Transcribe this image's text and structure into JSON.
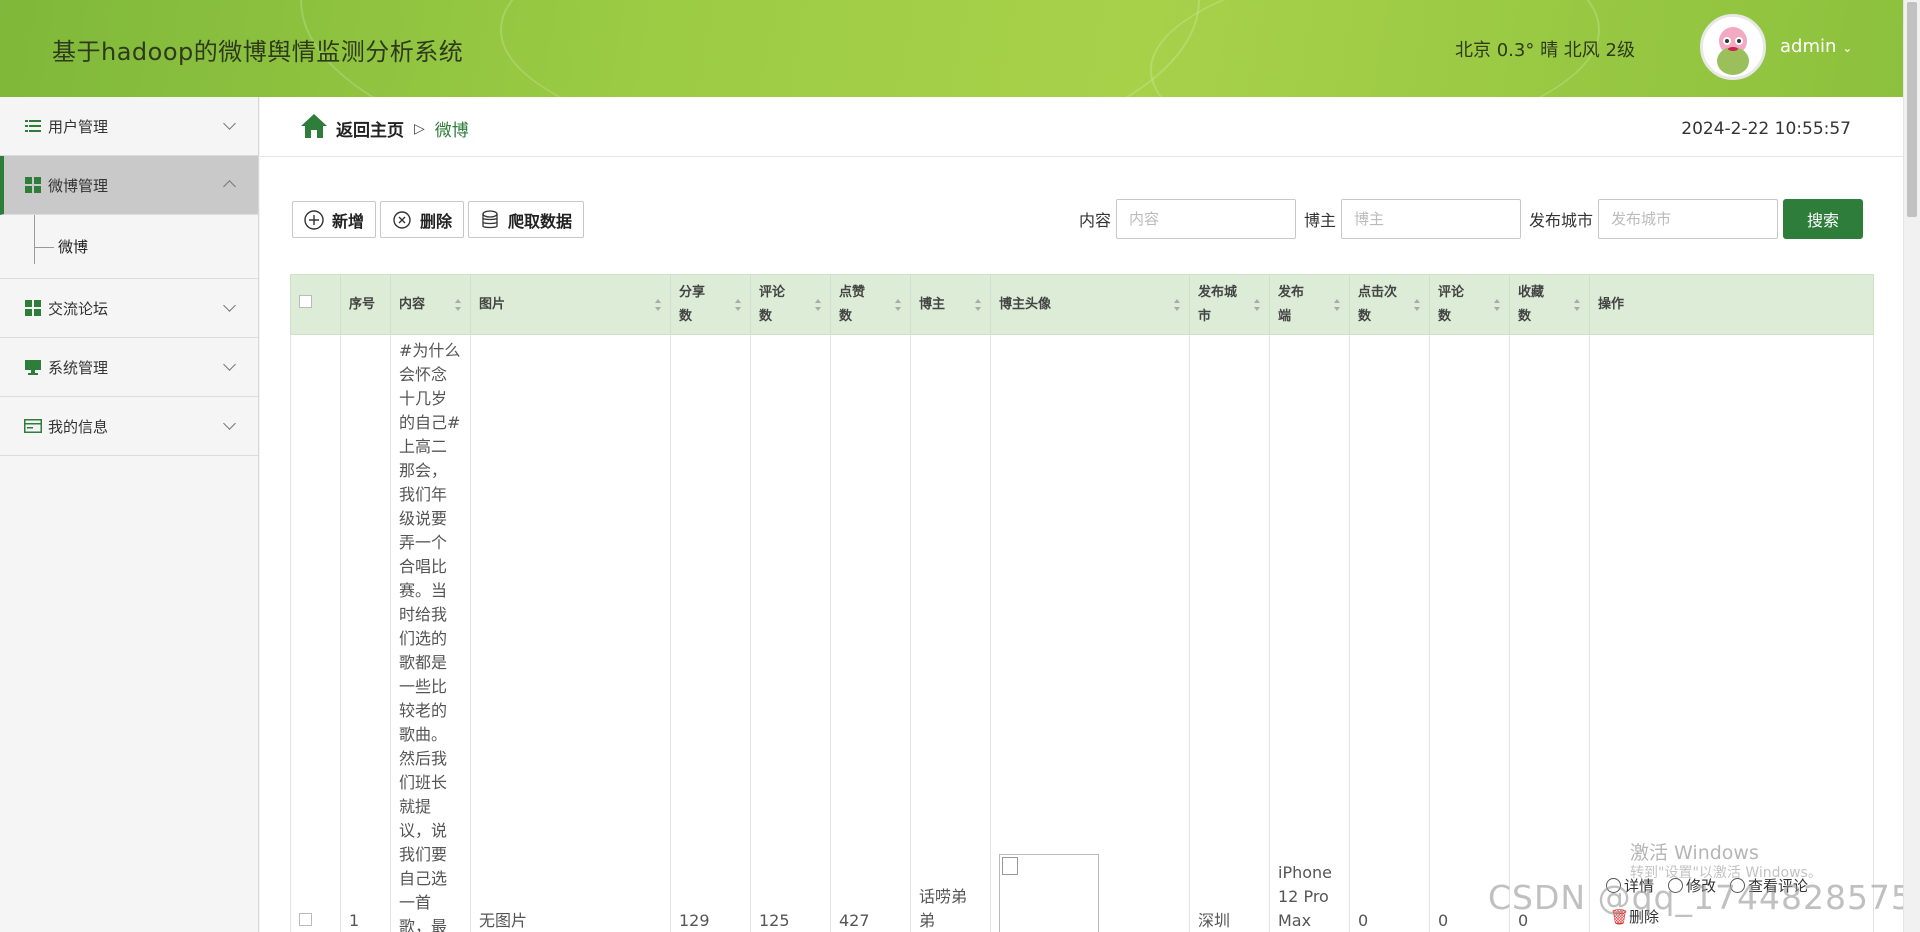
{
  "header": {
    "title": "基于hadoop的微博舆情监测分析系统",
    "weather": "北京 0.3° 晴 北风 2级",
    "username": "admin"
  },
  "sidebar": {
    "items": [
      {
        "label": "用户管理",
        "icon": "list-icon"
      },
      {
        "label": "微博管理",
        "icon": "grid-icon",
        "active": true
      },
      {
        "label": "交流论坛",
        "icon": "grid-icon"
      },
      {
        "label": "系统管理",
        "icon": "monitor-icon"
      },
      {
        "label": "我的信息",
        "icon": "card-icon"
      }
    ],
    "sub_item": "微博"
  },
  "breadcrumb": {
    "home": "返回主页",
    "separator": "▷",
    "current": "微博"
  },
  "datetime": "2024-2-22 10:55:57",
  "toolbar": {
    "add": "新增",
    "delete": "删除",
    "crawl": "爬取数据"
  },
  "search": {
    "content_label": "内容",
    "content_placeholder": "内容",
    "blogger_label": "博主",
    "blogger_placeholder": "博主",
    "city_label": "发布城市",
    "city_placeholder": "发布城市",
    "button": "搜索"
  },
  "table": {
    "headers": [
      "序号",
      "内容",
      "图片",
      "分享数",
      "评论数",
      "点赞数",
      "博主",
      "博主头像",
      "发布城市",
      "发布端",
      "点击次数",
      "评论数",
      "收藏数",
      "操作"
    ],
    "header_display": {
      "share": "分享\n数",
      "comment": "评论\n数",
      "like": "点赞\n数",
      "city": "发布城\n市",
      "client": "发布\n端",
      "clicks": "点击次\n数",
      "comments2": "评论\n数",
      "fav": "收藏\n数"
    },
    "row": {
      "index": "1",
      "content": "#为什么会怀念十几岁的自己#上高二那会，我们年级说要弄一个合唱比赛。当时给我们选的歌都是一些比较老的歌曲。然后我们班长就提议，说我们要自己选一首歌，最",
      "image": "无图片",
      "shares": "129",
      "comments": "125",
      "likes": "427",
      "blogger": "话唠弟弟",
      "city": "深圳",
      "client": "iPhone 12 Pro Max",
      "clicks": "0",
      "comments2": "0",
      "favorites": "0",
      "ops": [
        "详情",
        "修改",
        "查看评论",
        "删除"
      ]
    }
  },
  "colors": {
    "accent": "#2e7d3a",
    "header_bg": "#9ccc44",
    "table_head_bg": "#dcecd6"
  },
  "watermark": {
    "line1": "激活 Windows",
    "line2": "转到\"设置\"以激活 Windows。",
    "csdn": "CSDN @qq_1744828575"
  }
}
